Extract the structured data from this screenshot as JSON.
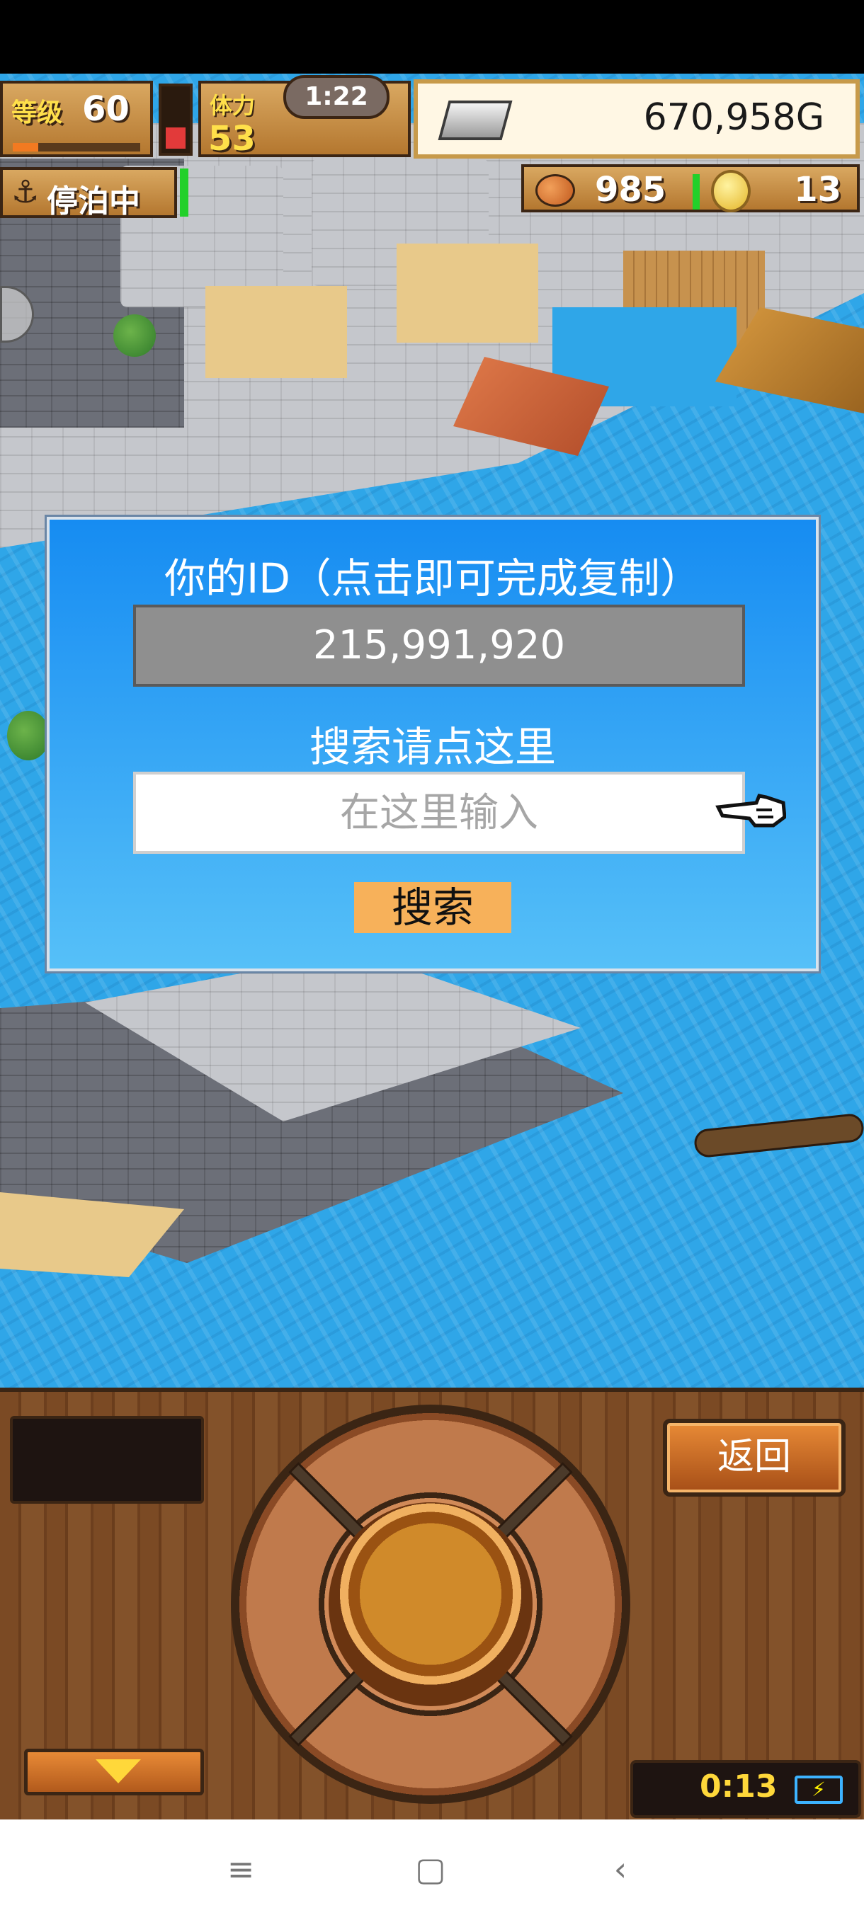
{
  "hud": {
    "level_label": "等级",
    "level_value": "60",
    "level_progress": 0.2,
    "energy_level": 0.45,
    "stamina_label": "体力",
    "stamina_value": "53",
    "timer": "1:22",
    "gold": "670,958G",
    "status_label": "停泊中",
    "food_value": "985",
    "coin_value": "13"
  },
  "dialog": {
    "title": "你的ID（点击即可完成复制）",
    "id_value": "215,991,920",
    "search_hint": "搜索请点这里",
    "search_placeholder": "在这里输入",
    "search_button": "搜索"
  },
  "panel": {
    "back_button": "返回",
    "countdown": "0:13"
  },
  "navbar": {
    "menu_icon": "≡",
    "home_icon": "▢",
    "back_icon": "‹"
  },
  "colors": {
    "dialog_top": "#168cf2",
    "dialog_bottom": "#56c0f8",
    "search_button": "#f7b15a",
    "water": "#2fa6e8"
  }
}
